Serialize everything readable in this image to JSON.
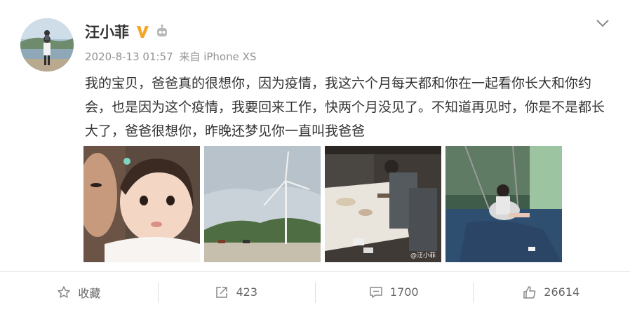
{
  "post": {
    "username": "汪小菲",
    "timestamp": "2020-8-13 01:57",
    "source_label": "来自",
    "device": "iPhone XS",
    "content": "我的宝贝，爸爸真的很想你，因为疫情，我这六个月每天都和你在一起看你长大和你约会，也是因为这个疫情，我要回来工作，快两个月没见了。不知道再见时，你是不是都长大了，爸爸很想你，昨晚还梦见你一直叫我爸爸",
    "watermark": "@汪小菲"
  },
  "actions": {
    "favorite": "收藏",
    "repost_count": "423",
    "comment_count": "1700",
    "like_count": "26614"
  },
  "colors": {
    "verify_badge": "#f5a623",
    "text": "#333333",
    "meta": "#939393",
    "divider": "#e7e7e7"
  },
  "icons": [
    "verified-v-icon",
    "robot-badge-icon",
    "chevron-down-icon",
    "star-icon",
    "repost-icon",
    "comment-icon",
    "thumbs-up-icon"
  ]
}
